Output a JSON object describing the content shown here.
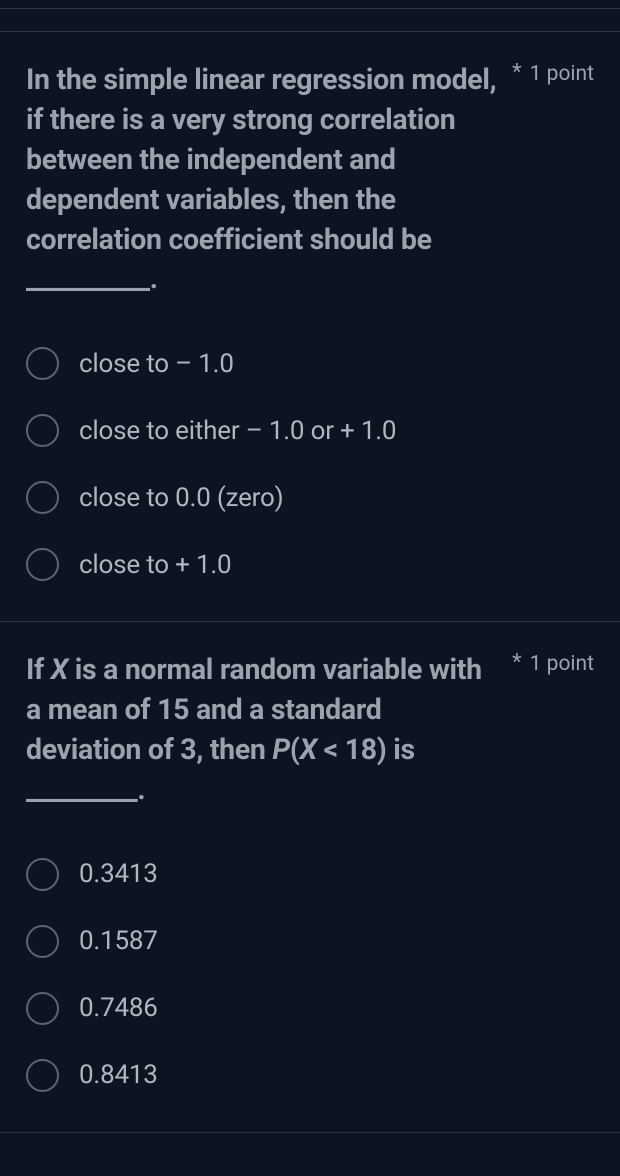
{
  "questions": [
    {
      "text_html": "In the simple linear regression model, if there is a very strong correlation between the independent and dependent variables, then the correlation coefficient should be __________.",
      "required_mark": "*",
      "points_label": "1 point",
      "options": [
        {
          "label": "close to – 1.0"
        },
        {
          "label": "close to either – 1.0 or + 1.0"
        },
        {
          "label": "close to 0.0 (zero)"
        },
        {
          "label": "close to + 1.0"
        }
      ]
    },
    {
      "text_html": "If <span class=\"italic\">X</span> is a normal random variable with a mean of 15 and a standard deviation of 3, then <span class=\"italic\">P</span>(<span class=\"italic\">X</span> < 18) is _________.",
      "required_mark": "*",
      "points_label": "1 point",
      "options": [
        {
          "label": "0.3413"
        },
        {
          "label": "0.1587"
        },
        {
          "label": "0.7486"
        },
        {
          "label": "0.8413"
        }
      ]
    }
  ]
}
